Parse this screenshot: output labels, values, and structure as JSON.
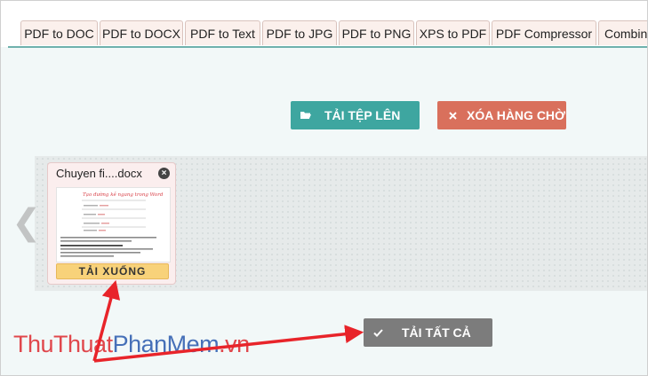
{
  "tabs": [
    "PDF to DOC",
    "PDF to DOCX",
    "PDF to Text",
    "PDF to JPG",
    "PDF to PNG",
    "XPS to PDF",
    "PDF Compressor",
    "Combine"
  ],
  "toolbar": {
    "upload_label": "TẢI TỆP LÊN",
    "upload_icon": "folder-open-icon",
    "clear_label": "XÓA HÀNG CHỜ",
    "clear_icon": "close-icon"
  },
  "queue": {
    "file_name": "Chuyen fi....docx",
    "thumbnail_title": "Tạo đường kẻ ngang trong Word",
    "download_label": "TẢI XUỐNG"
  },
  "download_all": {
    "label": "TẢI TẤT CẢ",
    "icon": "check-icon"
  },
  "watermark": {
    "part1": "ThuThuat",
    "part2": "PhanMem",
    "part3": ".vn"
  },
  "colors": {
    "teal": "#3ea6a0",
    "salmon": "#d9705c",
    "gray_button": "#7c7c7c",
    "download_yellow": "#f8d27a",
    "annotation_red": "#e8242a"
  }
}
